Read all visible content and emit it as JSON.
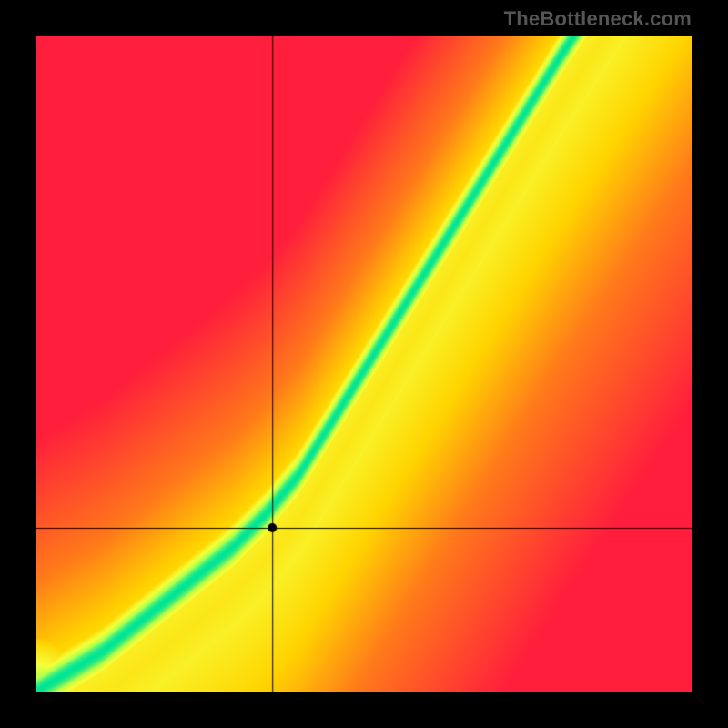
{
  "watermark": "TheBottleneck.com",
  "chart_data": {
    "type": "heatmap",
    "title": "",
    "xlabel": "",
    "ylabel": "",
    "xlim": [
      0,
      1
    ],
    "ylim": [
      0,
      1
    ],
    "crosshair": {
      "x": 0.36,
      "y": 0.25
    },
    "ridge": [
      {
        "x": 0.0,
        "y": 0.0
      },
      {
        "x": 0.05,
        "y": 0.03
      },
      {
        "x": 0.1,
        "y": 0.06
      },
      {
        "x": 0.15,
        "y": 0.1
      },
      {
        "x": 0.2,
        "y": 0.14
      },
      {
        "x": 0.25,
        "y": 0.18
      },
      {
        "x": 0.3,
        "y": 0.22
      },
      {
        "x": 0.35,
        "y": 0.27
      },
      {
        "x": 0.4,
        "y": 0.33
      },
      {
        "x": 0.45,
        "y": 0.41
      },
      {
        "x": 0.5,
        "y": 0.49
      },
      {
        "x": 0.55,
        "y": 0.57
      },
      {
        "x": 0.6,
        "y": 0.65
      },
      {
        "x": 0.65,
        "y": 0.73
      },
      {
        "x": 0.7,
        "y": 0.81
      },
      {
        "x": 0.75,
        "y": 0.89
      },
      {
        "x": 0.8,
        "y": 0.97
      },
      {
        "x": 0.82,
        "y": 1.0
      }
    ],
    "color_stops": [
      {
        "t": 0.0,
        "color": "#ff1e3c"
      },
      {
        "t": 0.35,
        "color": "#ff7a1a"
      },
      {
        "t": 0.55,
        "color": "#ffd400"
      },
      {
        "t": 0.75,
        "color": "#f6ff3a"
      },
      {
        "t": 0.88,
        "color": "#b4ff4a"
      },
      {
        "t": 1.0,
        "color": "#00e596"
      }
    ],
    "ridge_half_width": 0.035,
    "secondary_ridge_offset": 0.12
  }
}
